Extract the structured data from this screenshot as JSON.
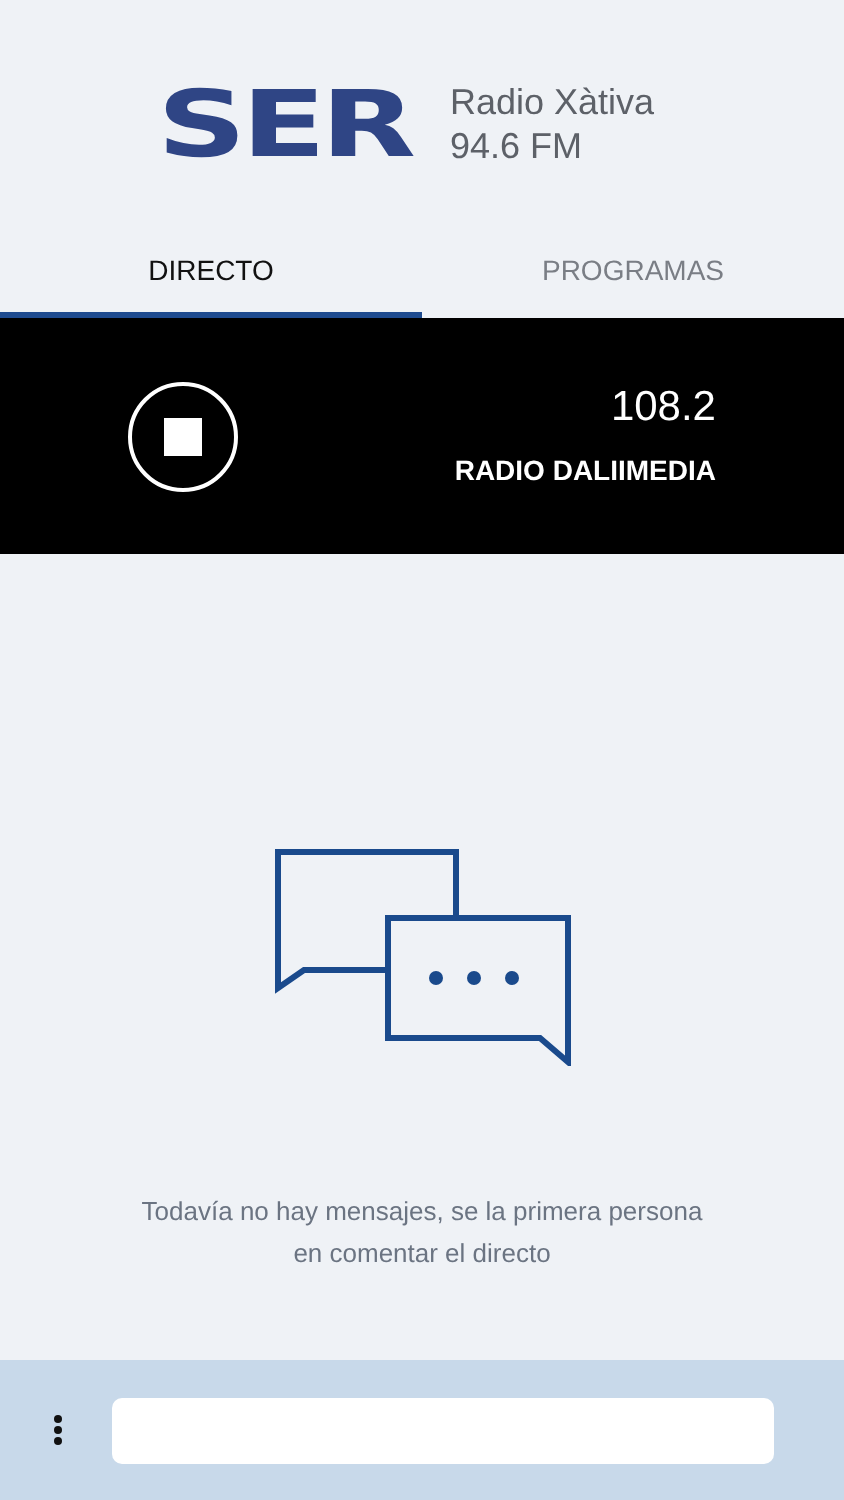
{
  "header": {
    "logo": "SER",
    "station": "Radio Xàtiva",
    "frequency": "94.6 FM"
  },
  "tabs": [
    {
      "label": "DIRECTO",
      "selected": true
    },
    {
      "label": "PROGRAMAS",
      "selected": false
    }
  ],
  "player": {
    "playing": true,
    "frequency": "108.2",
    "station": "RADIO DALIIMEDIA"
  },
  "chat": {
    "empty_message": "Todavía no hay mensajes, se la primera persona en comentar el directo"
  }
}
